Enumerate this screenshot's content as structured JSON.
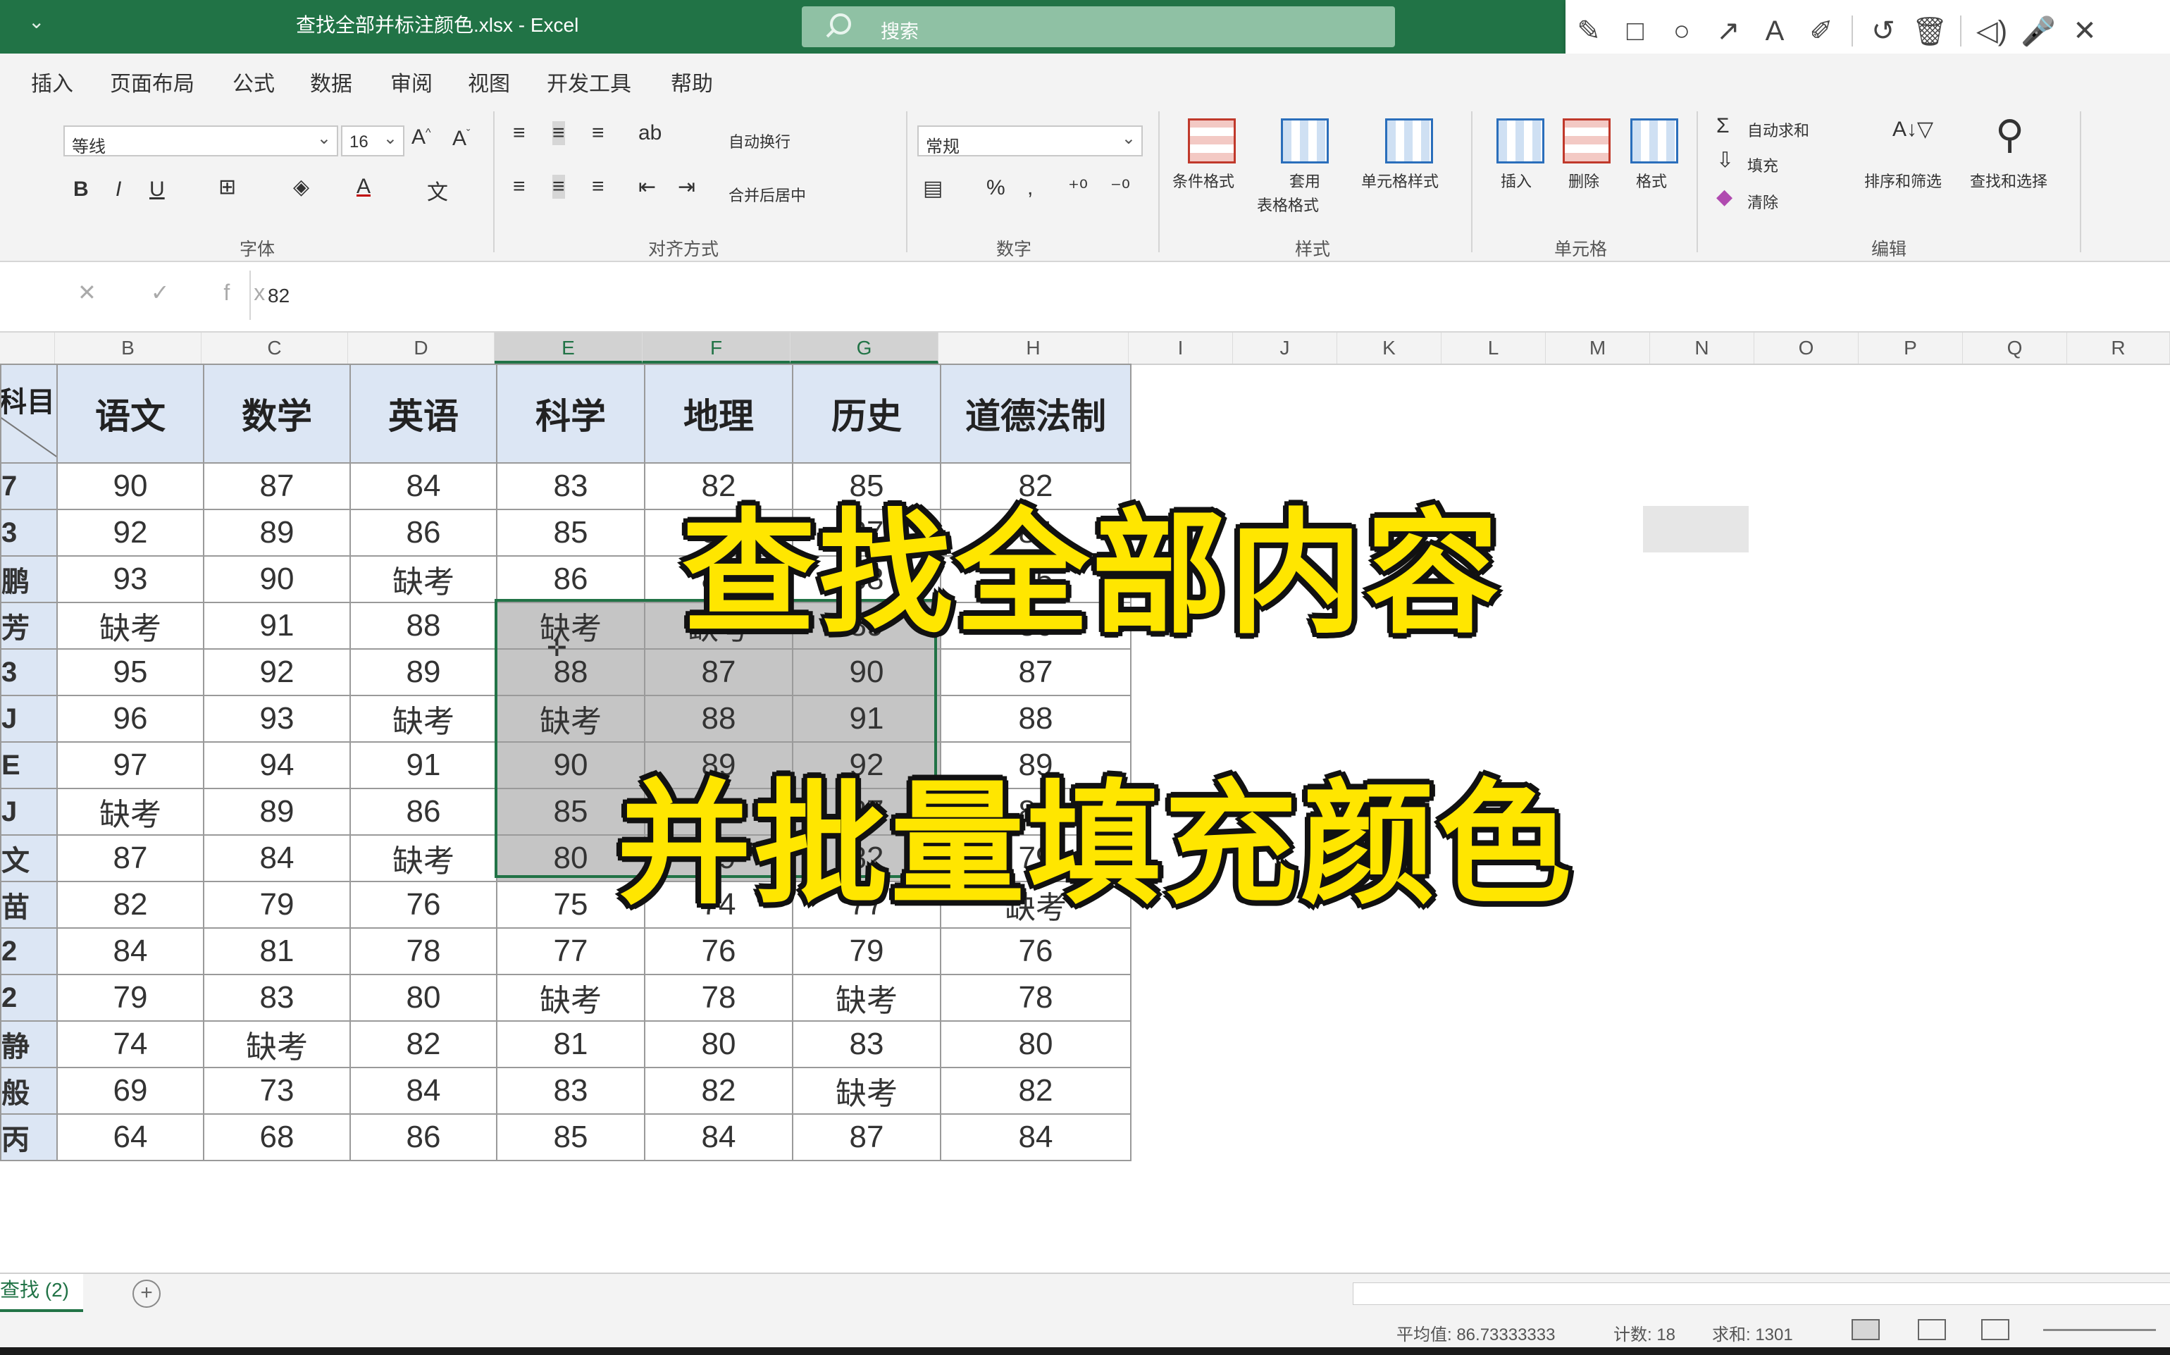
{
  "window": {
    "qat": "⌄",
    "title": "查找全部并标注颜色.xlsx - Excel",
    "search_placeholder": "搜索"
  },
  "pen_toolbar": [
    "✎",
    "□",
    "○",
    "↗",
    "A",
    "✐",
    "↺",
    "🗑",
    "◁)",
    "🎤",
    "✕"
  ],
  "menu": [
    "插入",
    "页面布局",
    "公式",
    "数据",
    "审阅",
    "视图",
    "开发工具",
    "帮助"
  ],
  "ribbon": {
    "font_name": "等线",
    "font_size": "16",
    "font_group": "字体",
    "align_group": "对齐方式",
    "wrap_text": "自动换行",
    "merge_center": "合并后居中",
    "number_format": "常规",
    "number_group": "数字",
    "styles_group": "样式",
    "cond_format": "条件格式",
    "table_format_1": "套用",
    "table_format_2": "表格格式",
    "cell_style": "单元格样式",
    "cells_group": "单元格",
    "insert": "插入",
    "delete": "删除",
    "format": "格式",
    "edit_group": "编辑",
    "autosum": "自动求和",
    "fill": "填充",
    "clear": "清除",
    "sort_filter": "排序和筛选",
    "find_select": "查找和选择"
  },
  "formula_bar": {
    "icons": "✕ ✓ fx",
    "value": "82"
  },
  "columns": [
    "B",
    "C",
    "D",
    "E",
    "F",
    "G",
    "H",
    "I",
    "J",
    "K",
    "L",
    "M",
    "N",
    "O",
    "P",
    "Q",
    "R"
  ],
  "table": {
    "corner_label": "科目",
    "headers": [
      "语文",
      "数学",
      "英语",
      "科学",
      "地理",
      "历史",
      "道德法制"
    ],
    "name_fragments": [
      "7",
      "3",
      "鹏",
      "芳",
      "3",
      "J",
      "E",
      "J",
      "文",
      "苗",
      "2",
      "2",
      "静",
      "般",
      "丙"
    ],
    "rows": [
      [
        "90",
        "87",
        "84",
        "83",
        "82",
        "85",
        "82"
      ],
      [
        "92",
        "89",
        "86",
        "85",
        "84",
        "87",
        "84"
      ],
      [
        "93",
        "90",
        "缺考",
        "86",
        "85",
        "88",
        "85"
      ],
      [
        "缺考",
        "91",
        "88",
        "缺考",
        "缺考",
        "89",
        "86"
      ],
      [
        "95",
        "92",
        "89",
        "88",
        "87",
        "90",
        "87"
      ],
      [
        "96",
        "93",
        "缺考",
        "缺考",
        "88",
        "91",
        "88"
      ],
      [
        "97",
        "94",
        "91",
        "90",
        "89",
        "92",
        "89"
      ],
      [
        "缺考",
        "89",
        "86",
        "85",
        "84",
        "87",
        "84"
      ],
      [
        "87",
        "84",
        "缺考",
        "80",
        "79",
        "82",
        "79"
      ],
      [
        "82",
        "79",
        "76",
        "75",
        "74",
        "77",
        "缺考"
      ],
      [
        "84",
        "81",
        "78",
        "77",
        "76",
        "79",
        "76"
      ],
      [
        "79",
        "83",
        "80",
        "缺考",
        "78",
        "缺考",
        "78"
      ],
      [
        "74",
        "缺考",
        "82",
        "81",
        "80",
        "83",
        "80"
      ],
      [
        "69",
        "73",
        "84",
        "83",
        "82",
        "缺考",
        "82"
      ],
      [
        "64",
        "68",
        "86",
        "85",
        "84",
        "87",
        "84"
      ]
    ]
  },
  "overlay": {
    "line1": "查找全部内容",
    "line2": "并批量填充颜色"
  },
  "sheet": {
    "tab": "查找 (2)",
    "add": "+"
  },
  "status": {
    "average": "平均值: 86.73333333",
    "count": "计数: 18",
    "sum": "求和: 1301"
  },
  "colors": {
    "excel_green": "#217346",
    "header_fill": "#dce6f4",
    "selection_fill": "#c5c5c5",
    "overlay_text": "#ffe600"
  }
}
